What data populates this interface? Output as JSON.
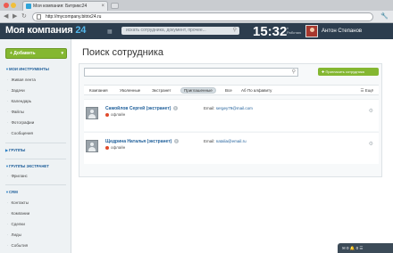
{
  "browser": {
    "tab_title": "Моя компания: Битрикс24",
    "tab_close": "×",
    "url": "http://mycompany.bitrix24.ru",
    "nav_back": "◀",
    "nav_forward": "▶",
    "nav_reload": "↻",
    "settings": "🔧"
  },
  "header": {
    "logo_text": "Моя компания",
    "logo_num": "24",
    "search_placeholder": "искать сотрудника, документ, прочее...",
    "time": "15:32",
    "clock_line1": "⏸",
    "clock_line2": "Работаю",
    "user_name": "Антон Степанов"
  },
  "sidebar": {
    "add_button": "+ Добавить",
    "add_caret": "▾",
    "sections": [
      {
        "label": "МОИ ИНСТРУМЕНТЫ"
      },
      {
        "label": "ГРУППЫ"
      },
      {
        "label": "ГРУППЫ ЭКСТРАНЕТ"
      },
      {
        "label": "CRM"
      }
    ],
    "items_tools": [
      "Живая лента",
      "Задачи",
      "Календарь",
      "Файлы",
      "Фотографии",
      "Сообщения"
    ],
    "items_extranet": [
      "Фриланс"
    ],
    "items_crm": [
      "Контакты",
      "Компании",
      "Сделки",
      "Лиды",
      "События"
    ]
  },
  "main": {
    "page_title": "Поиск сотрудника",
    "search_value": "",
    "invite_button": "✚ Пригласить сотрудника",
    "filters": [
      "Компания",
      "Уволенные",
      "Экстранет",
      "Приглашенные",
      "Все",
      "Аб По алфавиту"
    ],
    "active_filter": "Приглашенные",
    "right_control": "☰ Ещё",
    "users": [
      {
        "name": "Самойлов Сергей (экстранет)",
        "q": "?",
        "status": "офлайн",
        "email_label": "Email:",
        "email": "sergey79@mail.com",
        "gear": "⚙"
      },
      {
        "name": "Щедрина Наталья (экстранет)",
        "q": "?",
        "status": "офлайн",
        "email_label": "Email:",
        "email": "natalia@email.ru",
        "gear": "⚙"
      }
    ]
  },
  "bottom_bar": {
    "text": "✉ 0   🔔 0   ☰"
  },
  "colors": {
    "header_bg": "#2c3d4e",
    "accent_green": "#84b731",
    "link_blue": "#1f5f9a",
    "offline_red": "#e04a2b",
    "sidebar_bg": "#eef2f4"
  }
}
